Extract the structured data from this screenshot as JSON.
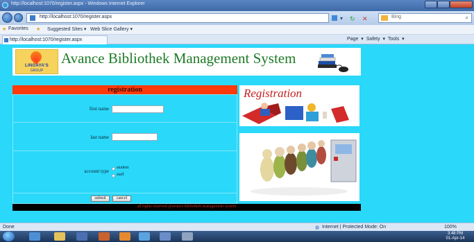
{
  "window": {
    "title": "http://localhost:1070/register.aspx - Windows Internet Explorer"
  },
  "address_bar": {
    "url": "http://localhost:1070/register.aspx",
    "search_placeholder": "Bing"
  },
  "favorites_bar": {
    "favorites_label": "Favorites",
    "suggested_label": "Suggested Sites ▾",
    "web_slice_label": "Web Slice Gallery ▾"
  },
  "tab": {
    "label": "http://localhost:1070/register.aspx"
  },
  "command_bar": {
    "text": "Page ▾  Safety ▾  Tools ▾"
  },
  "site": {
    "logo_line1": "LINGAYA'S",
    "logo_line2": "GROUP",
    "title": "Avance Bibliothek Management System"
  },
  "registration": {
    "header": "registration",
    "first_name_label": "first name",
    "first_name_value": "",
    "last_name_label": "last name",
    "last_name_value": "",
    "account_type_label": "account type",
    "options": [
      "student",
      "staff"
    ],
    "submit_label": "submit",
    "cancel_label": "cancel"
  },
  "footer": {
    "text": "all rights reserved @avance bibliothek management system"
  },
  "images": {
    "registration_word": "Registration"
  },
  "status_bar": {
    "left": "Done",
    "mode": "Internet | Protected Mode: On",
    "zoom": "100%"
  },
  "taskbar": {
    "time": "3:48 PM",
    "date": "01-Apr-14"
  },
  "colors": {
    "page_bg": "#2ad8f9",
    "accent": "#ff3a0a",
    "title_green": "#1d7a25"
  }
}
